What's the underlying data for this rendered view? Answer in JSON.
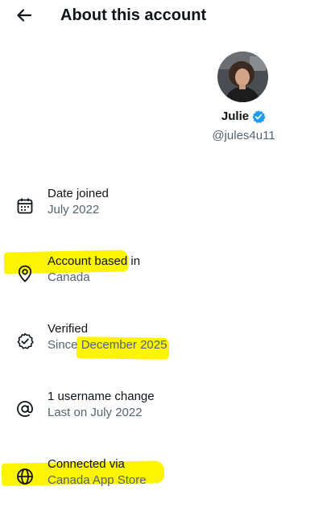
{
  "header": {
    "title": "About this account",
    "back_icon": "arrow-left-icon"
  },
  "profile": {
    "name": "Julie",
    "handle": "@jules4u11",
    "verified_icon": "verified-badge-icon",
    "verified_color": "#1d9bf0"
  },
  "highlight_color": "#fcf400",
  "items": [
    {
      "icon": "calendar-icon",
      "label": "Date joined",
      "value": "July 2022"
    },
    {
      "icon": "location-pin-icon",
      "label_a": "Account based",
      "label_b": " in",
      "value": "Canada"
    },
    {
      "icon": "verified-check-icon",
      "label": "Verified",
      "value_a": "Since ",
      "value_b": "December 2025"
    },
    {
      "icon": "at-sign-icon",
      "label": "1 username change",
      "value": "Last on July 2022"
    },
    {
      "icon": "globe-icon",
      "label": "Connected via",
      "value": "Canada App Store"
    }
  ]
}
